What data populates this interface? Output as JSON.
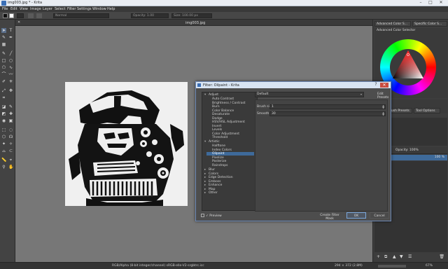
{
  "window": {
    "title": "img003.jpg * - Krita",
    "minimize": "–",
    "maximize": "□",
    "close": "✕"
  },
  "menu": [
    "File",
    "Edit",
    "View",
    "Image",
    "Layer",
    "Select",
    "Filter",
    "Settings",
    "Window",
    "Help"
  ],
  "tool_options": {
    "blend_mode": "Normal",
    "opacity": "Opacity: 1.00",
    "size": "Size: 100.00 px"
  },
  "document": {
    "tab_title": "img003.jpg"
  },
  "dialog": {
    "title": "Filter: Oilpaint - Krita",
    "categories": [
      {
        "label": "Adjust",
        "expanded": true,
        "items": [
          "Auto Contrast",
          "Brightness / Contrast",
          "Burn",
          "Color Balance",
          "Desaturate",
          "Dodge",
          "HSV/HSL Adjustment",
          "Invert",
          "Levels",
          "Color Adjustment",
          "Threshold"
        ]
      },
      {
        "label": "Artistic",
        "expanded": true,
        "items": [
          "Halftone",
          "Index Colors",
          "Oilpaint",
          "Pixelize",
          "Posterize",
          "Raindrops"
        ]
      },
      {
        "label": "Blur",
        "expanded": false,
        "items": []
      },
      {
        "label": "Colors",
        "expanded": false,
        "items": []
      },
      {
        "label": "Edge Detection",
        "expanded": false,
        "items": []
      },
      {
        "label": "Emboss",
        "expanded": false,
        "items": []
      },
      {
        "label": "Enhance",
        "expanded": false,
        "items": []
      },
      {
        "label": "Map",
        "expanded": false,
        "items": []
      },
      {
        "label": "Other",
        "expanded": false,
        "items": []
      }
    ],
    "selected_item": "Oilpaint",
    "preset": "Default",
    "edit_presets": "Edit Presets",
    "params": [
      {
        "label": "Brush size:",
        "value": "1"
      },
      {
        "label": "Smooth:",
        "value": "30"
      }
    ],
    "preview_label": "Preview",
    "preview_checked": "✓",
    "create_mask": "Create Filter Mask",
    "ok": "OK",
    "cancel": "Cancel"
  },
  "right_dock": {
    "tabs": [
      "Advanced Color S...",
      "Specific Color S..."
    ],
    "color_panel_title": "Advanced Color Selector",
    "brush_tabs": [
      "Brush Presets",
      "Tool Options"
    ],
    "opacity": "Opacity: 100%",
    "layer_name": "Layer 1",
    "layer_opacity": "100 %"
  },
  "status": {
    "color_info": "RGB/Alpha (8-bit integer/channel)  sRGB-elle-V2-srgbtrc.icc",
    "dimensions": "294 × 372 (2.8M)",
    "zoom": "67%"
  }
}
